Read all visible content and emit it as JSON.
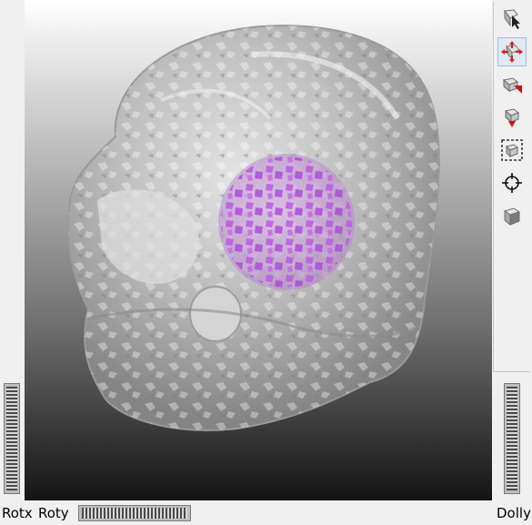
{
  "viewer": {
    "scene": "skull-volume-with-tumor",
    "colors": {
      "background_top": "#ffffff",
      "background_bottom": "#141414",
      "skull": "#d0d0d0",
      "tumor": "#c060e0"
    }
  },
  "toolbar": {
    "tools": [
      {
        "name": "select-tool",
        "icon": "arrow-cursor-icon",
        "active": false
      },
      {
        "name": "rotate-view-tool",
        "icon": "rotate-arrows-icon",
        "active": true
      },
      {
        "name": "seek-tool",
        "icon": "seek-icon",
        "active": false
      },
      {
        "name": "set-home-tool",
        "icon": "home-icon",
        "active": false
      },
      {
        "name": "view-all-tool",
        "icon": "view-all-icon",
        "active": false
      },
      {
        "name": "seek-point-tool",
        "icon": "crosshair-icon",
        "active": false
      },
      {
        "name": "projection-tool",
        "icon": "cube-icon",
        "active": false
      }
    ]
  },
  "bottom_bar": {
    "rotx_label": "Rotx",
    "roty_label": "Roty",
    "dolly_label": "Dolly"
  }
}
